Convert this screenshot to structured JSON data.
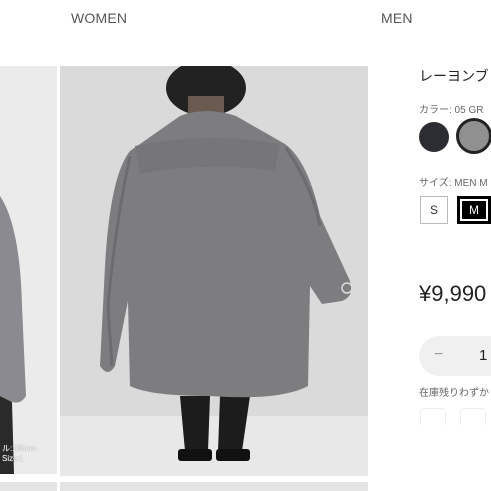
{
  "nav": {
    "women": "WOMEN",
    "men": "MEN"
  },
  "gallery": {
    "thumb_caption_line1": "ル:185cm",
    "thumb_caption_line2": "Size:L"
  },
  "product": {
    "name": "レーヨンブ",
    "color_label": "カラー: 05 GR",
    "size_label": "サイズ: MEN M",
    "sizes": [
      "S",
      "M"
    ],
    "selected_size": "M",
    "price": "¥9,990",
    "quantity_minus": "−",
    "quantity": "1",
    "stock_note": "在庫残りわずか"
  },
  "colors": {
    "swatch_black": "#2c2c33",
    "swatch_gray": "#909090",
    "shirt": "#7d7d80",
    "background": "#dcdcdc"
  }
}
